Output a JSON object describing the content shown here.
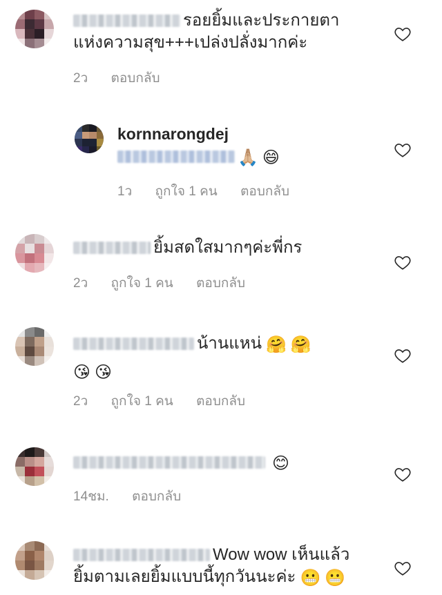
{
  "comments": [
    {
      "text_line1": "รอยยิ้มและประกายตา",
      "text_line2": "แห่งความสุข+++เปล่งปลั่งมากค่ะ",
      "time": "2ว",
      "reply": "ตอบกลับ"
    },
    {
      "username": "kornnarongdej",
      "emojis": [
        "🙏🏼",
        "😄"
      ],
      "time": "1ว",
      "likes": "ถูกใจ 1 คน",
      "reply": "ตอบกลับ"
    },
    {
      "text_line1": "ยิ้มสดใสมากๆค่ะพี่กร",
      "time": "2ว",
      "likes": "ถูกใจ 1 คน",
      "reply": "ตอบกลับ"
    },
    {
      "text_line1": "น้านแหน่",
      "emojis_line1": [
        "🤗",
        "🤗"
      ],
      "emojis_line2": [
        "😘",
        "😘"
      ],
      "time": "2ว",
      "likes": "ถูกใจ 1 คน",
      "reply": "ตอบกลับ"
    },
    {
      "emojis": [
        "😊"
      ],
      "time": "14ชม.",
      "reply": "ตอบกลับ"
    },
    {
      "text_line1": "Wow wow เห็นแล้ว",
      "text_line2": "ยิ้มตามเลยยิ้มแบบนี้ทุกวันนะค่ะ",
      "emojis_line2": [
        "😬",
        "😬"
      ]
    }
  ],
  "icons": {
    "like": "heart-outline-icon"
  }
}
